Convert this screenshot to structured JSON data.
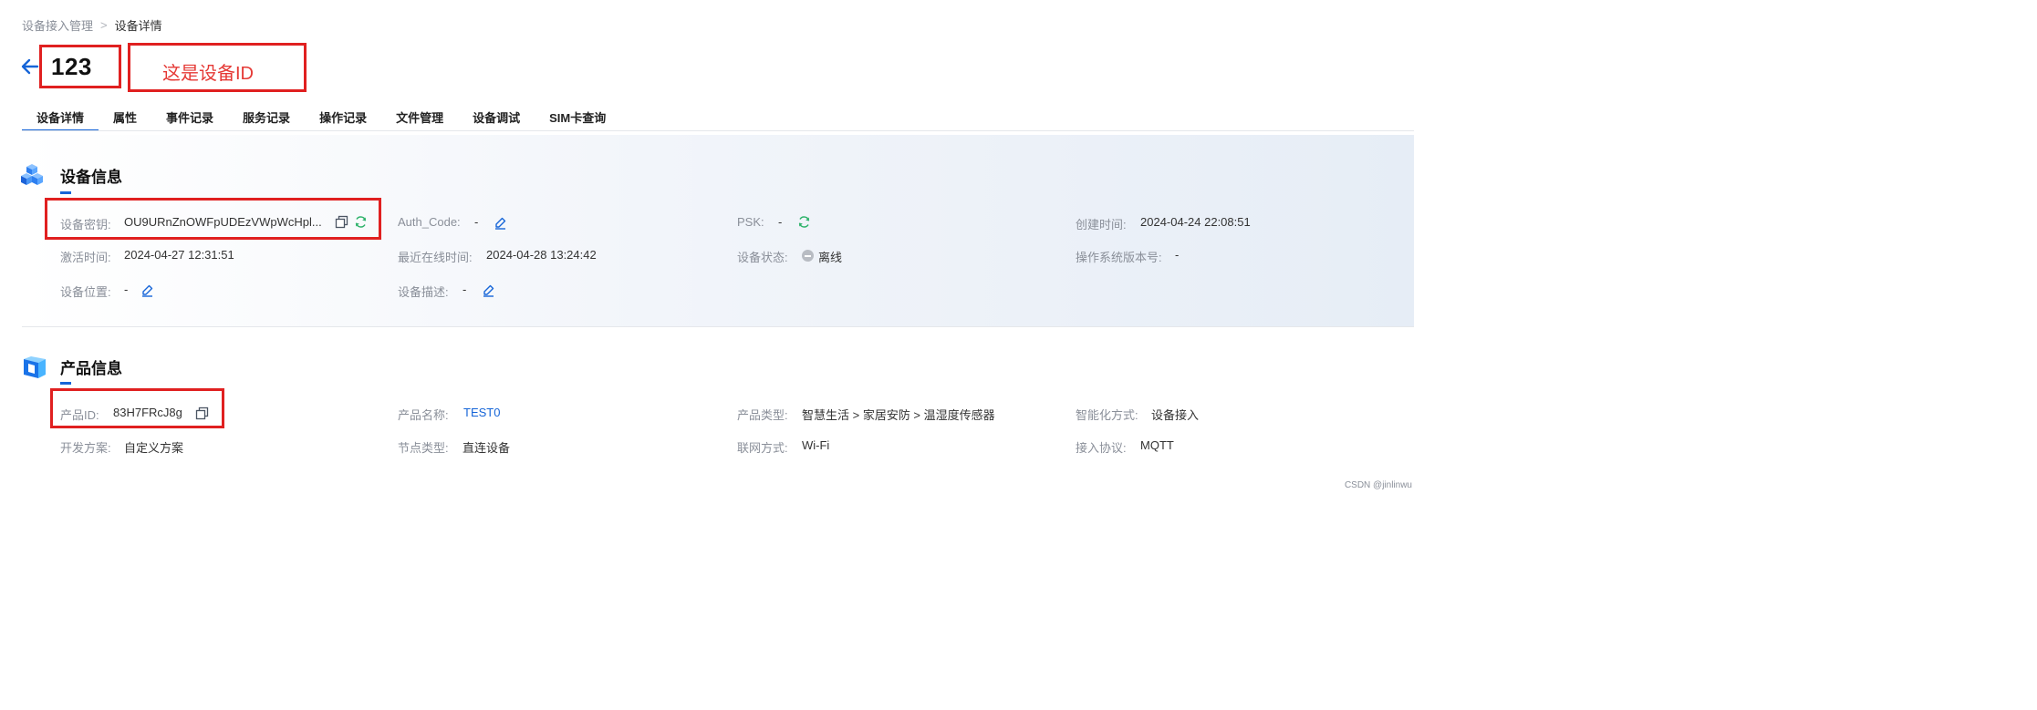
{
  "breadcrumb": {
    "parent": "设备接入管理",
    "separator": ">",
    "current": "设备详情"
  },
  "header": {
    "title": "123",
    "annotation": "这是设备ID"
  },
  "tabs": [
    "设备详情",
    "属性",
    "事件记录",
    "服务记录",
    "操作记录",
    "文件管理",
    "设备调试",
    "SIM卡查询"
  ],
  "device_info": {
    "title": "设备信息",
    "secret_label": "设备密钥:",
    "secret_value": "OU9URnZnOWFpUDEzVWpWcHpl...",
    "auth_label": "Auth_Code:",
    "auth_value": "-",
    "psk_label": "PSK:",
    "psk_value": "-",
    "created_label": "创建时间:",
    "created_value": "2024-04-24 22:08:51",
    "activated_label": "激活时间:",
    "activated_value": "2024-04-27 12:31:51",
    "online_label": "最近在线时间:",
    "online_value": "2024-04-28 13:24:42",
    "status_label": "设备状态:",
    "status_value": "离线",
    "os_label": "操作系统版本号:",
    "os_value": "-",
    "location_label": "设备位置:",
    "location_value": "-",
    "desc_label": "设备描述:",
    "desc_value": "-"
  },
  "product_info": {
    "title": "产品信息",
    "id_label": "产品ID:",
    "id_value": "83H7FRcJ8g",
    "name_label": "产品名称:",
    "name_value": "TEST0",
    "type_label": "产品类型:",
    "type_value": "智慧生活 > 家居安防 > 温湿度传感器",
    "smart_label": "智能化方式:",
    "smart_value": "设备接入",
    "dev_label": "开发方案:",
    "dev_value": "自定义方案",
    "node_label": "节点类型:",
    "node_value": "直连设备",
    "net_label": "联网方式:",
    "net_value": "Wi-Fi",
    "proto_label": "接入协议:",
    "proto_value": "MQTT"
  },
  "footer": {
    "watermark": "CSDN @jinlinwu"
  },
  "colors": {
    "accent": "#1665d8",
    "annotation": "#e53935",
    "refresh": "#2fb36b",
    "offline": "#b8bcc3"
  },
  "icons": [
    "back-arrow-icon",
    "device-cubes-icon",
    "product-box-icon",
    "copy-icon",
    "refresh-icon",
    "edit-icon",
    "offline-dot-icon"
  ]
}
